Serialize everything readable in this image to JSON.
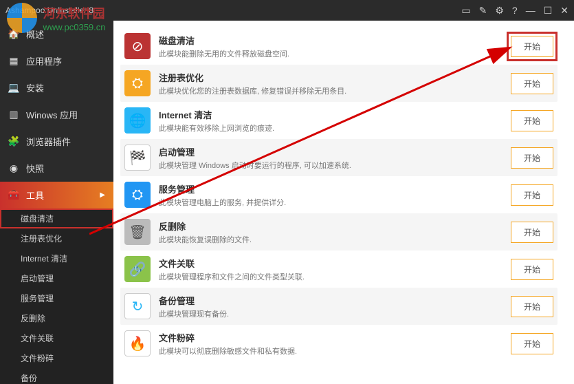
{
  "app_title": "Ashampoo UnInstaller 8",
  "watermark": {
    "line1": "河东软件园",
    "line2": "www.pc0359.cn"
  },
  "titlebar_icons": [
    "msg-icon",
    "edit-icon",
    "gear-icon",
    "help-icon",
    "min-icon",
    "max-icon",
    "close-icon"
  ],
  "sidebar": {
    "items": [
      {
        "icon": "🏠",
        "label": "概述"
      },
      {
        "icon": "▦",
        "label": "应用程序"
      },
      {
        "icon": "💻",
        "label": "安装"
      },
      {
        "icon": "▥",
        "label": "Winows 应用"
      },
      {
        "icon": "🧩",
        "label": "浏览器插件"
      },
      {
        "icon": "◉",
        "label": "快照"
      },
      {
        "icon": "🧰",
        "label": "工具",
        "active": true
      }
    ],
    "sub": [
      {
        "label": "磁盘清洁",
        "hl": true
      },
      {
        "label": "注册表优化"
      },
      {
        "label": "Internet 清洁"
      },
      {
        "label": "启动管理"
      },
      {
        "label": "服务管理"
      },
      {
        "label": "反删除"
      },
      {
        "label": "文件关联"
      },
      {
        "label": "文件粉碎"
      },
      {
        "label": "备份"
      }
    ]
  },
  "tools": [
    {
      "title": "磁盘清洁",
      "desc": "此模块能删除无用的文件释放磁盘空间.",
      "icon": "ic-disk",
      "glyph": "⊘",
      "alt": false,
      "hl": true
    },
    {
      "title": "注册表优化",
      "desc": "此模块优化您的注册表数据库, 修复错误并移除无用条目.",
      "icon": "ic-reg",
      "glyph": "⛭",
      "alt": true
    },
    {
      "title": "Internet 清洁",
      "desc": "此模块能有效移除上网浏览的痕迹.",
      "icon": "ic-net",
      "glyph": "🌐",
      "alt": false
    },
    {
      "title": "启动管理",
      "desc": "此模块管理 Windows 启动时要运行的程序, 可以加速系统.",
      "icon": "ic-start",
      "glyph": "🏁",
      "alt": true
    },
    {
      "title": "服务管理",
      "desc": "此模块管理电脑上的服务, 并提供详分.",
      "icon": "ic-svc",
      "glyph": "⛭",
      "alt": false
    },
    {
      "title": "反删除",
      "desc": "此模块能恢复误删除的文件.",
      "icon": "ic-undel",
      "glyph": "🗑",
      "alt": true
    },
    {
      "title": "文件关联",
      "desc": "此模块管理程序和文件之间的文件类型关联.",
      "icon": "ic-assoc",
      "glyph": "🔗",
      "alt": false
    },
    {
      "title": "备份管理",
      "desc": "此模块管理现有备份.",
      "icon": "ic-backup",
      "glyph": "↻",
      "alt": true
    },
    {
      "title": "文件粉碎",
      "desc": "此模块可以彻底删除敏感文件和私有数据.",
      "icon": "ic-shred",
      "glyph": "🔥",
      "alt": false
    }
  ],
  "start_label": "开始"
}
